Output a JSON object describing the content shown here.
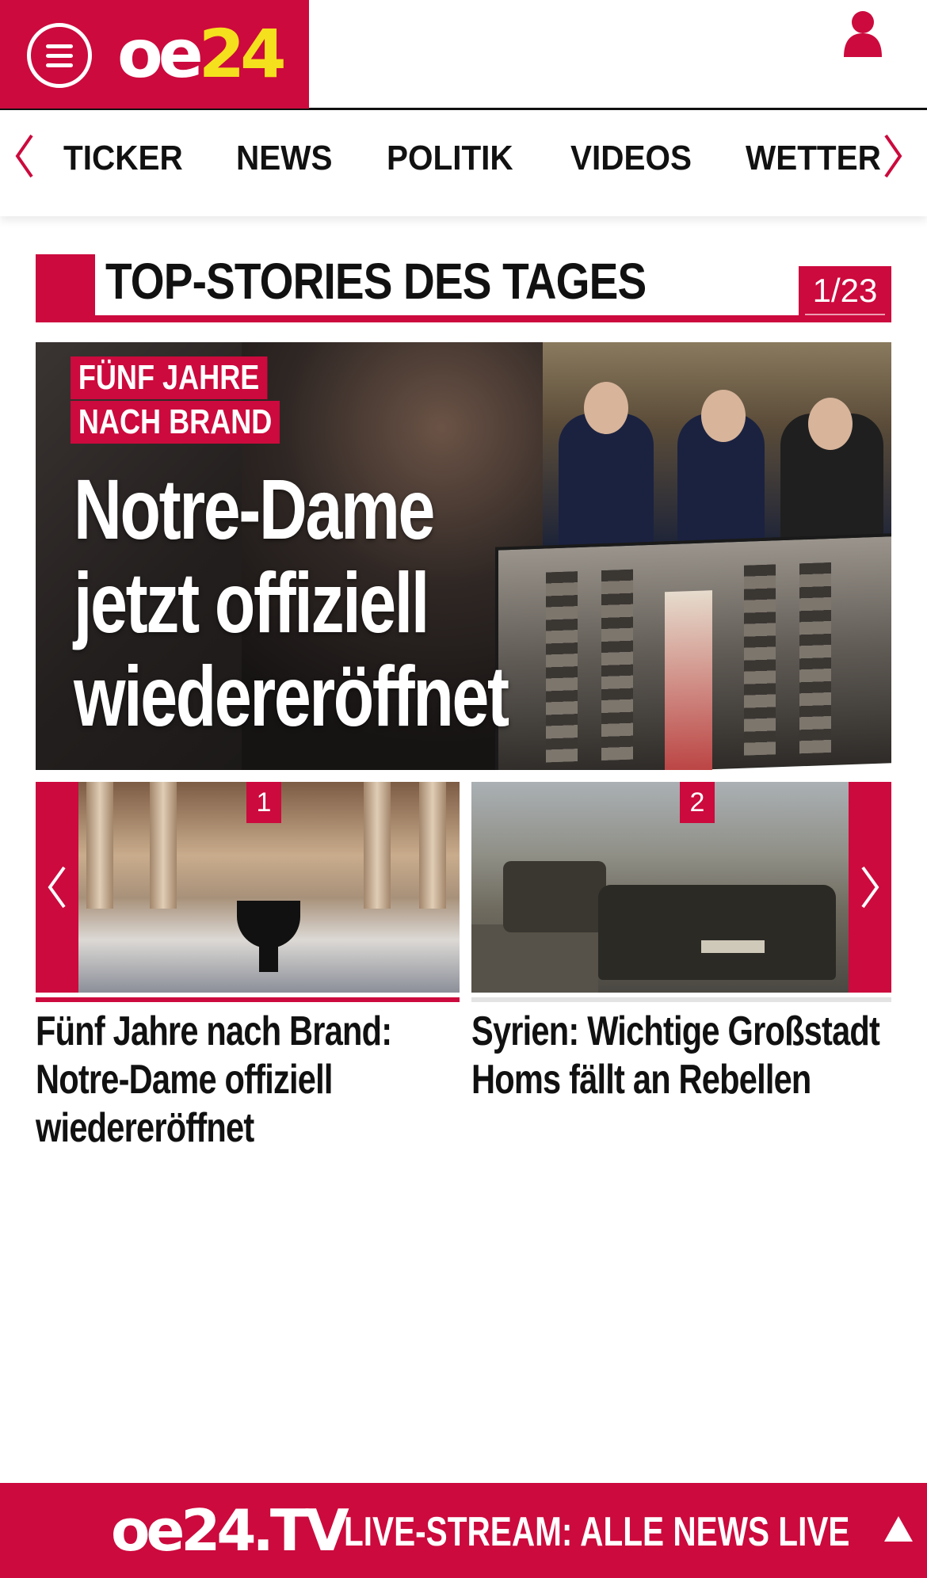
{
  "header": {
    "logo_oe": "oe",
    "logo_24": "24"
  },
  "nav": {
    "items": [
      "TICKER",
      "NEWS",
      "POLITIK",
      "VIDEOS",
      "WETTER"
    ]
  },
  "section": {
    "title": "TOP-STORIES DES TAGES",
    "counter": "1/23"
  },
  "hero": {
    "kicker_line1": "FÜNF JAHRE",
    "kicker_line2": "NACH BRAND",
    "headline_line1": "Notre-Dame",
    "headline_line2": "jetzt offiziell",
    "headline_line3": "wiedereröffnet"
  },
  "carousel": {
    "cards": [
      {
        "number": "1",
        "title": "Fünf Jahre nach Brand: Notre-Dame offiziell wiedereröffnet"
      },
      {
        "number": "2",
        "title": "Syrien: Wichtige Großstadt Homs fällt an Rebellen"
      }
    ]
  },
  "bottom_bar": {
    "logo": "oe24.TV",
    "text": "LIVE-STREAM:  ALLE NEWS LIVE"
  },
  "colors": {
    "brand_red": "#cc0a3d",
    "logo_yellow": "#f5e01e"
  },
  "icons": [
    "menu-icon",
    "user-icon",
    "chevron-left-icon",
    "chevron-right-icon",
    "arrow-up-icon"
  ]
}
